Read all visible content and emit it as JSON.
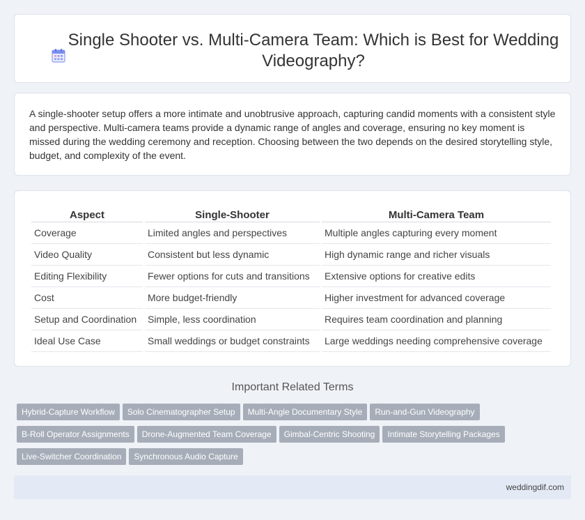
{
  "header": {
    "title": "Single Shooter vs. Multi-Camera Team: Which is Best for Wedding Videography?",
    "icon": "calendar-icon"
  },
  "intro": {
    "text": "A single-shooter setup offers a more intimate and unobtrusive approach, capturing candid moments with a consistent style and perspective. Multi-camera teams provide a dynamic range of angles and coverage, ensuring no key moment is missed during the wedding ceremony and reception. Choosing between the two depends on the desired storytelling style, budget, and complexity of the event."
  },
  "table": {
    "headers": [
      "Aspect",
      "Single-Shooter",
      "Multi-Camera Team"
    ],
    "rows": [
      [
        "Coverage",
        "Limited angles and perspectives",
        "Multiple angles capturing every moment"
      ],
      [
        "Video Quality",
        "Consistent but less dynamic",
        "High dynamic range and richer visuals"
      ],
      [
        "Editing Flexibility",
        "Fewer options for cuts and transitions",
        "Extensive options for creative edits"
      ],
      [
        "Cost",
        "More budget-friendly",
        "Higher investment for advanced coverage"
      ],
      [
        "Setup and Coordination",
        "Simple, less coordination",
        "Requires team coordination and planning"
      ],
      [
        "Ideal Use Case",
        "Small weddings or budget constraints",
        "Large weddings needing comprehensive coverage"
      ]
    ]
  },
  "related": {
    "title": "Important Related Terms",
    "tags": [
      "Hybrid-Capture Workflow",
      "Solo Cinematographer Setup",
      "Multi-Angle Documentary Style",
      "Run-and-Gun Videography",
      "B-Roll Operator Assignments",
      "Drone-Augmented Team Coverage",
      "Gimbal-Centric Shooting",
      "Intimate Storytelling Packages",
      "Live-Switcher Coordination",
      "Synchronous Audio Capture"
    ]
  },
  "footer": {
    "site": "weddingdif.com"
  },
  "colors": {
    "background": "#eff2f7",
    "tag_bg": "#a6adb8",
    "icon_accent": "#7b8ff0"
  }
}
